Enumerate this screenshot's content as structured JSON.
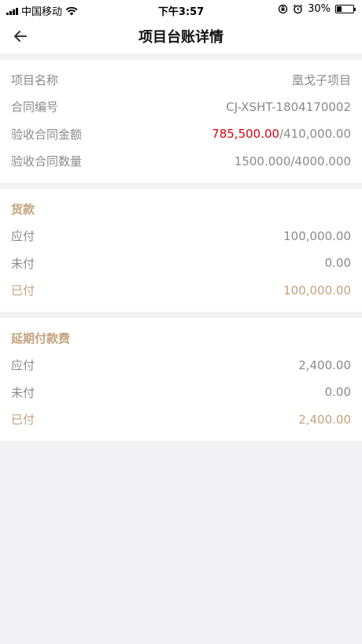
{
  "status_bar": {
    "carrier": "中国移动",
    "time": "下午3:57",
    "battery_percent": "30%",
    "battery_level": 0.3
  },
  "header": {
    "title": "项目台账详情"
  },
  "project": {
    "name_label": "项目名称",
    "name_value": "凰戈子项目",
    "contract_no_label": "合同编号",
    "contract_no_value": "CJ-XSHT-1804170002",
    "amount_label": "验收合同金额",
    "amount_accepted": "785,500.00",
    "amount_total": "/410,000.00",
    "quantity_label": "验收合同数量",
    "quantity_value": "1500.000/4000.000"
  },
  "goods": {
    "title": "货款",
    "payable_label": "应付",
    "payable_value": "100,000.00",
    "unpaid_label": "未付",
    "unpaid_value": "0.00",
    "paid_label": "已付",
    "paid_value": "100,000.00"
  },
  "late_fee": {
    "title": "延期付款费",
    "payable_label": "应付",
    "payable_value": "2,400.00",
    "unpaid_label": "未付",
    "unpaid_value": "0.00",
    "paid_label": "已付",
    "paid_value": "2,400.00"
  },
  "colors": {
    "accent_gold": "#c3a27c",
    "highlight_red": "#e4000f",
    "label_gray": "#8a8a8a",
    "background": "#f2f2f4"
  }
}
